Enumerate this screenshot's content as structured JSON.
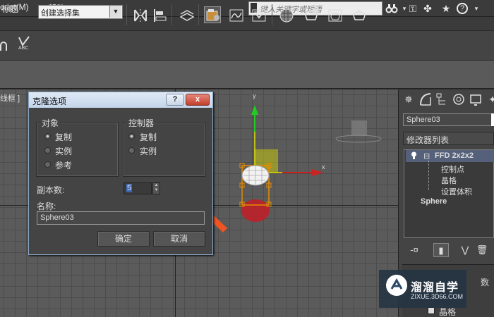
{
  "window": {
    "title": "标题"
  },
  "search": {
    "placeholder": "键入关键字或短语"
  },
  "menu": [
    {
      "label": "cript(M)"
    },
    {
      "label": "帮助(H)"
    }
  ],
  "toolbar": {
    "selection_set_value": "创建选择集",
    "abc_label": "ABC"
  },
  "viewport": {
    "label": "线框 ]",
    "axis_x": "x",
    "axis_y": "y"
  },
  "dialog": {
    "title": "克隆选项",
    "help_label": "?",
    "close_label": "x",
    "object_group": {
      "label": "对象",
      "options": [
        {
          "label": "复制",
          "selected": true
        },
        {
          "label": "实例",
          "selected": false
        },
        {
          "label": "参考",
          "selected": false
        }
      ]
    },
    "controller_group": {
      "label": "控制器",
      "options": [
        {
          "label": "复制",
          "selected": true
        },
        {
          "label": "实例",
          "selected": false
        }
      ]
    },
    "copies_label": "副本数:",
    "copies_value": "5",
    "name_label": "名称:",
    "name_value": "Sphere03",
    "ok_label": "确定",
    "cancel_label": "取消"
  },
  "command_panel": {
    "object_name": "Sphere03",
    "modifier_list_label": "修改器列表",
    "stack": [
      {
        "label": "FFD 2x2x2",
        "expand": "⊟"
      },
      {
        "label": "控制点"
      },
      {
        "label": "晶格"
      },
      {
        "label": "设置体积"
      },
      {
        "label": "Sphere"
      }
    ],
    "rollout_label": "数",
    "checkbox_label": "晶格"
  },
  "watermark": {
    "title": "溜溜自学",
    "subtitle": "ZIXUE.3D66.COM"
  },
  "colors": {
    "arrow_annotation": "#ee5522",
    "gizmo_y": "#22cc22",
    "gizmo_x": "#cc2222",
    "gizmo_plane": "#e0e000",
    "selection_box": "#e88c00"
  }
}
